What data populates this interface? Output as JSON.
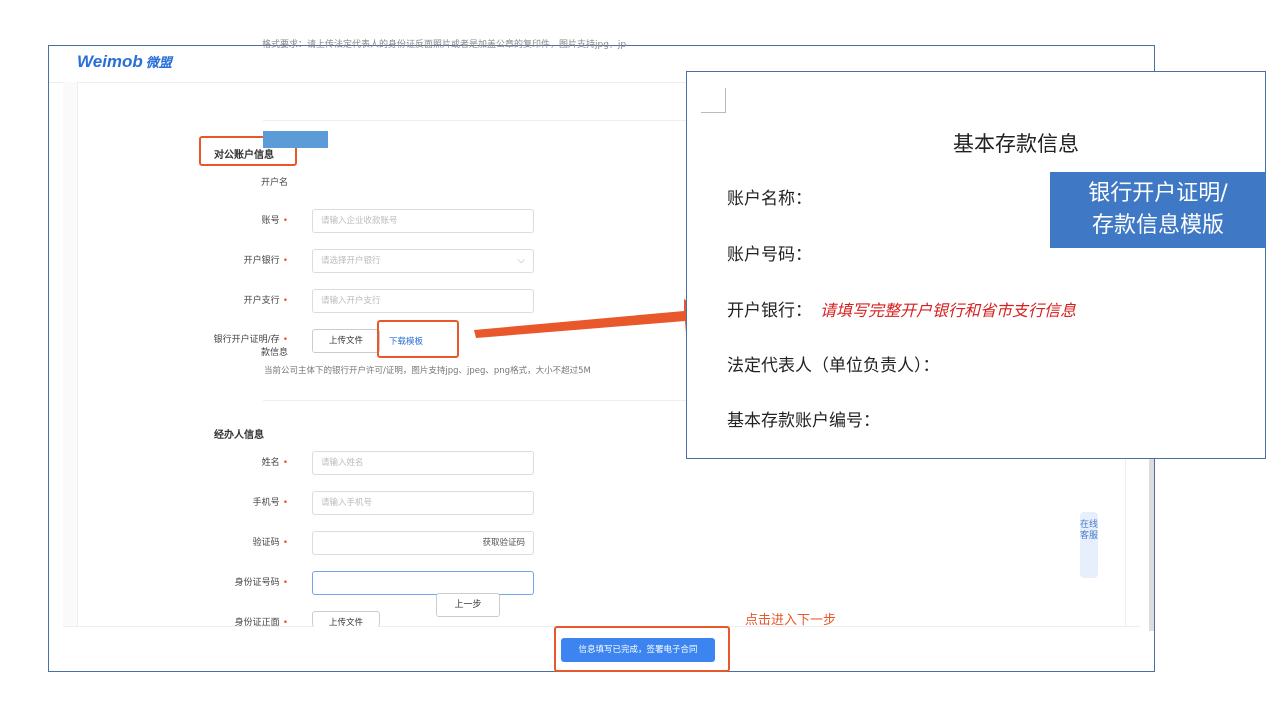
{
  "app": {
    "logo": "Weimob",
    "logo_cn": "微盟"
  },
  "top_hint": "格式要求：请上传法定代表人的身份证反面照片或者是加盖公章的复印件，图片支持jpg，jp",
  "account_section": {
    "title": "对公账户信息",
    "fields": {
      "holder": {
        "label": "开户名"
      },
      "account_no": {
        "label": "账号",
        "required": "•",
        "placeholder": "请输入企业收款账号"
      },
      "bank": {
        "label": "开户银行",
        "required": "•",
        "placeholder": "请选择开户银行"
      },
      "branch": {
        "label": "开户支行",
        "required": "•",
        "placeholder": "请输入开户支行"
      },
      "certificate": {
        "label_line1": "银行开户证明/存",
        "label_line2": "款信息",
        "required": "•",
        "upload": "上传文件",
        "download": "下载模板",
        "note": "当前公司主体下的银行开户许可/证明，图片支持jpg、jpeg、png格式，大小不超过5M"
      }
    }
  },
  "agent_section": {
    "title": "经办人信息",
    "fields": {
      "name": {
        "label": "姓名",
        "required": "•",
        "placeholder": "请输入姓名"
      },
      "phone": {
        "label": "手机号",
        "required": "•",
        "placeholder": "请输入手机号"
      },
      "code": {
        "label": "验证码",
        "required": "•",
        "button": "获取验证码"
      },
      "id_no": {
        "label": "身份证号码",
        "required": "•"
      },
      "id_front": {
        "label": "身份证正面",
        "required": "•",
        "upload": "上传文件"
      }
    }
  },
  "footer": {
    "prev": "上一步",
    "submit": "信息填写已完成，签署电子合同"
  },
  "service_tab": "在线客服",
  "annotation_next": "点击进入下一步",
  "popup": {
    "title": "基本存款信息",
    "rows": {
      "name": "账户名称：",
      "number": "账户号码：",
      "bank": "开户银行：",
      "bank_hint": "请填写完整开户银行和省市支行信息",
      "legal": "法定代表人（单位负责人）：",
      "basic_no": "基本存款账户编号："
    }
  },
  "callout": {
    "line1": "银行开户证明/",
    "line2": "存款信息模版"
  },
  "colors": {
    "accent_red": "#e8582b",
    "brand_blue": "#2a6fd6",
    "callout_blue": "#3f78c4",
    "primary_button": "#3c84f0"
  }
}
